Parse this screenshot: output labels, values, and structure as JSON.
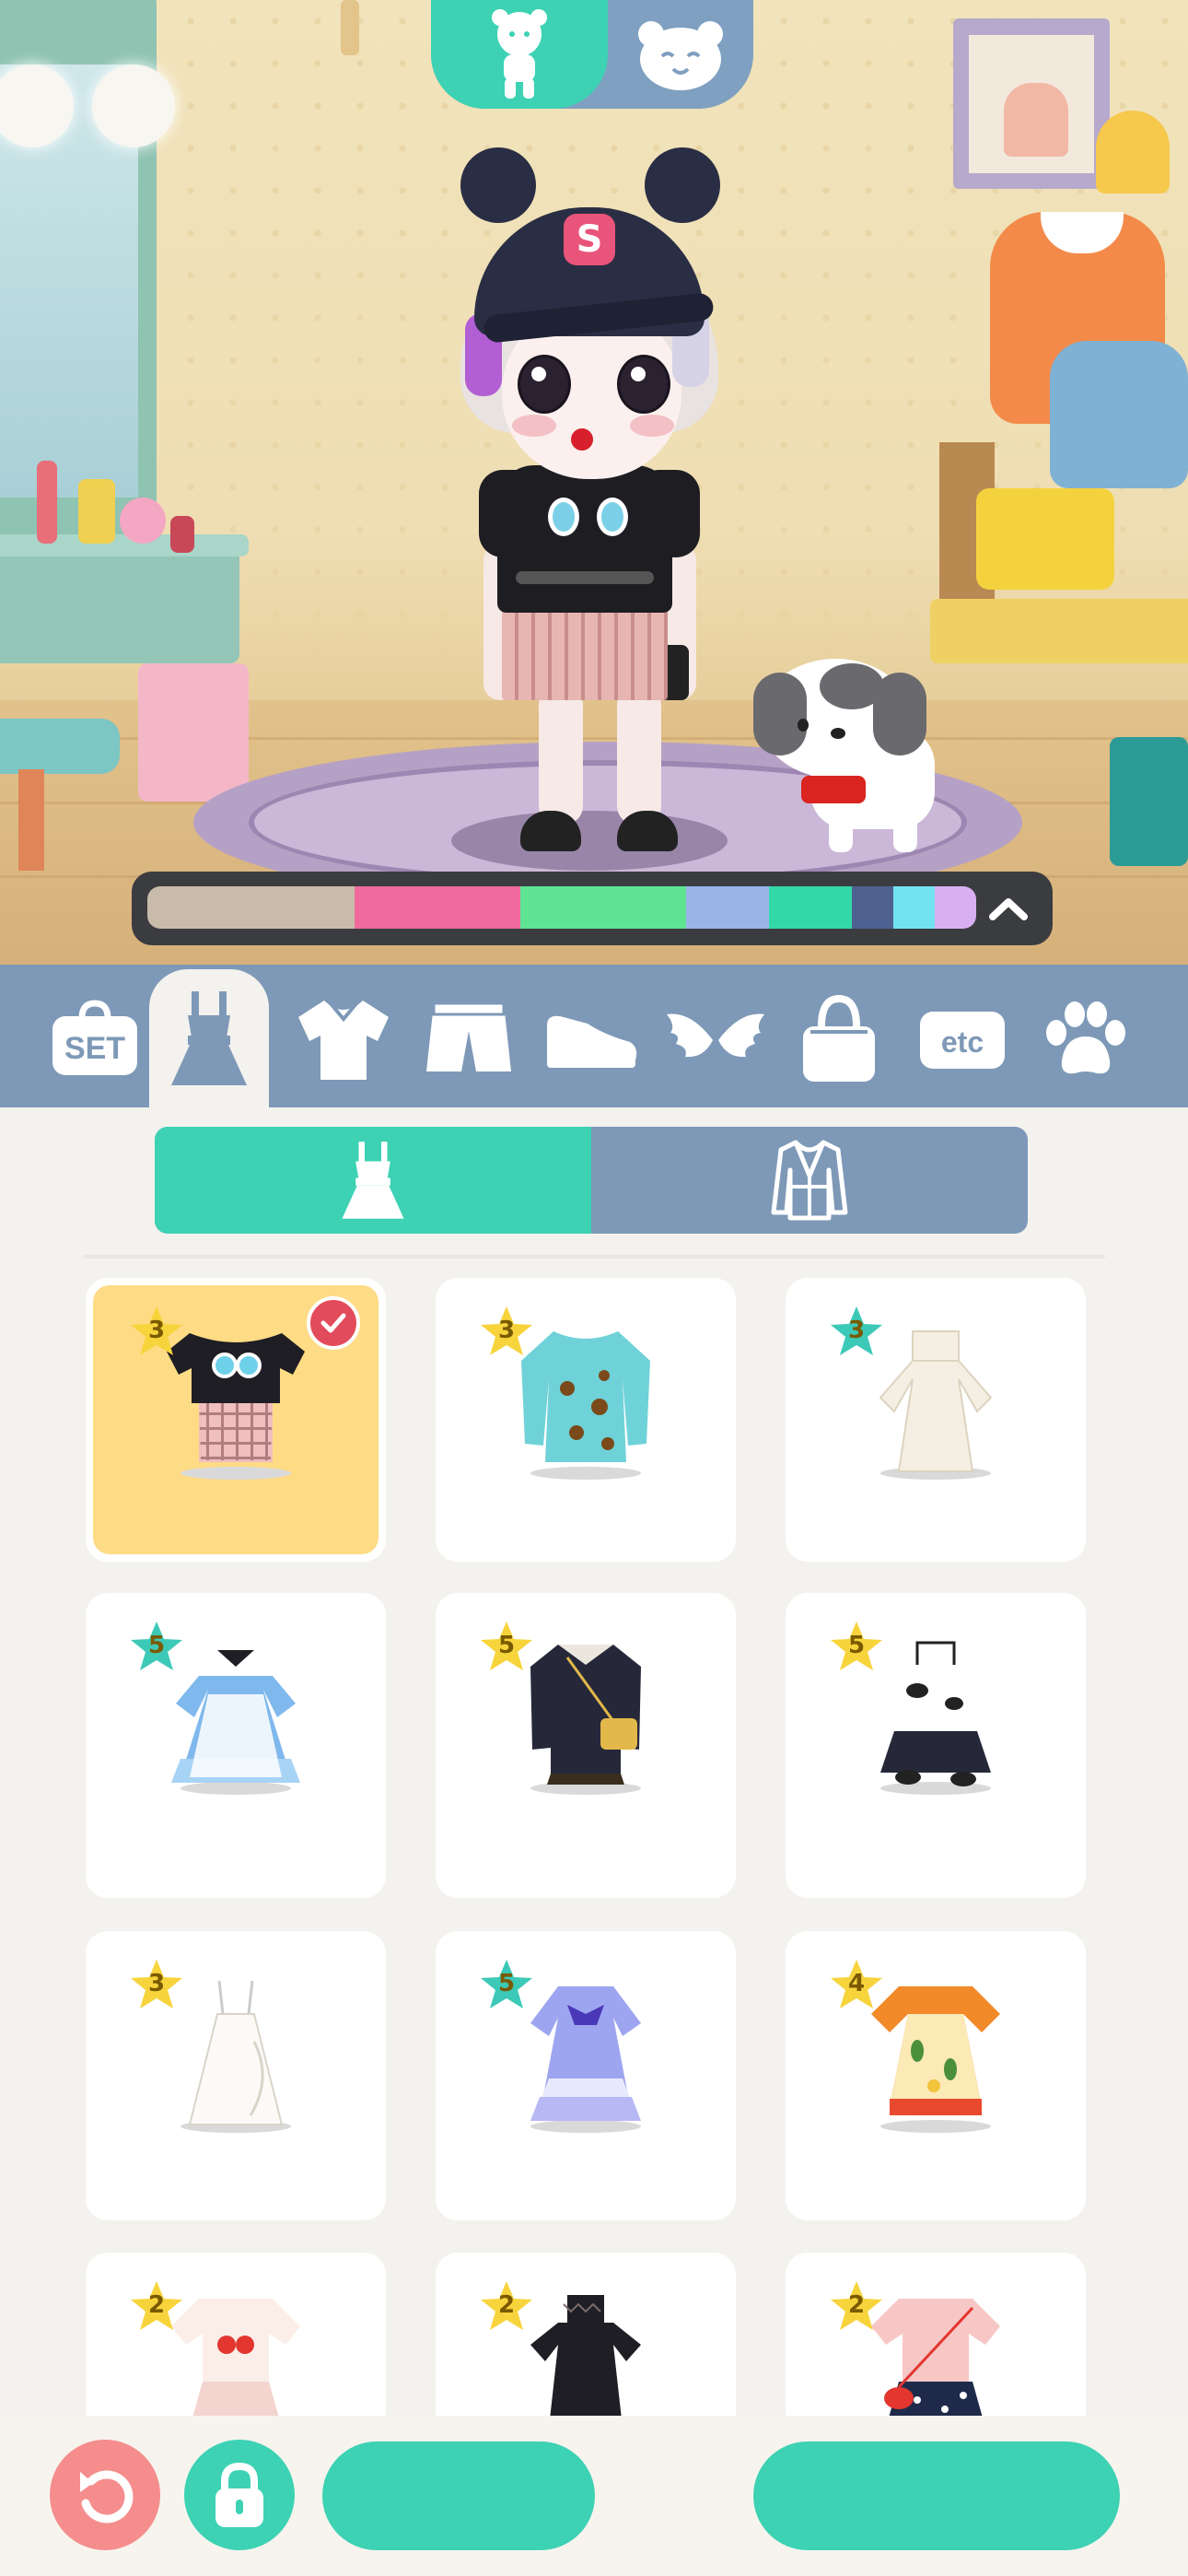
{
  "top_toggle": {
    "options": [
      {
        "icon": "bear-body-icon",
        "active": true
      },
      {
        "icon": "bear-face-icon",
        "active": false
      }
    ],
    "active_color": "#3dd2b4",
    "inactive_color": "#7fa0c0"
  },
  "hat_letter": "S",
  "palette": {
    "swatches": [
      "#c9bba9",
      "#f06a9d",
      "#f06a9d",
      "#5ee493",
      "#5ee493",
      "#9ab4e8",
      "#33d8a7",
      "#4e6191",
      "#72e2f0",
      "#d8b0f2"
    ],
    "expand_icon": "chevron-up-icon"
  },
  "categories": [
    {
      "id": "set",
      "label": "SET",
      "icon": "set-icon",
      "active": false
    },
    {
      "id": "dress",
      "label": "",
      "icon": "dress-icon",
      "active": true
    },
    {
      "id": "top",
      "label": "",
      "icon": "shirt-icon",
      "active": false
    },
    {
      "id": "bottom",
      "label": "",
      "icon": "shorts-icon",
      "active": false
    },
    {
      "id": "shoes",
      "label": "",
      "icon": "shoe-icon",
      "active": false
    },
    {
      "id": "wings",
      "label": "",
      "icon": "wings-icon",
      "active": false
    },
    {
      "id": "bag",
      "label": "",
      "icon": "bag-icon",
      "active": false
    },
    {
      "id": "etc",
      "label": "etc",
      "icon": "etc-icon",
      "active": false
    },
    {
      "id": "pet",
      "label": "",
      "icon": "paw-icon",
      "active": false
    }
  ],
  "sub_tabs": [
    {
      "icon": "dress-icon",
      "active": true
    },
    {
      "icon": "coat-icon",
      "active": false
    }
  ],
  "items": [
    {
      "stars": "3",
      "star_color": "#f7d43c",
      "selected": true,
      "art": "black-tee-plaid-skirt"
    },
    {
      "stars": "3",
      "star_color": "#f7d43c",
      "selected": false,
      "art": "teal-leopard-dress"
    },
    {
      "stars": "3",
      "star_color": "#3dc9b8",
      "selected": false,
      "art": "cream-maxi-dress"
    },
    {
      "stars": "5",
      "star_color": "#3dc9b8",
      "selected": false,
      "art": "blue-lolita-dress"
    },
    {
      "stars": "5",
      "star_color": "#f7d43c",
      "selected": false,
      "art": "navy-coat-dress"
    },
    {
      "stars": "5",
      "star_color": "#f7d43c",
      "selected": false,
      "art": "cow-print-dress"
    },
    {
      "stars": "3",
      "star_color": "#f7d43c",
      "selected": false,
      "art": "white-slip-dress"
    },
    {
      "stars": "5",
      "star_color": "#3dc9b8",
      "selected": false,
      "art": "lavender-ribbon-dress"
    },
    {
      "stars": "4",
      "star_color": "#f7d43c",
      "selected": false,
      "art": "fruit-print-dress"
    },
    {
      "stars": "2",
      "star_color": "#f7d43c",
      "selected": false,
      "art": "strawberry-tee-dress"
    },
    {
      "stars": "2",
      "star_color": "#f7d43c",
      "selected": false,
      "art": "black-lace-dress"
    },
    {
      "stars": "2",
      "star_color": "#f7d43c",
      "selected": false,
      "art": "pink-tee-polka-skirt"
    }
  ],
  "bottom_bar": {
    "undo_icon": "undo-icon",
    "lock_icon": "lock-icon",
    "left_button_label": "",
    "right_button_label": "",
    "undo_color": "#f58d8d",
    "accent": "#3dd2b4"
  }
}
